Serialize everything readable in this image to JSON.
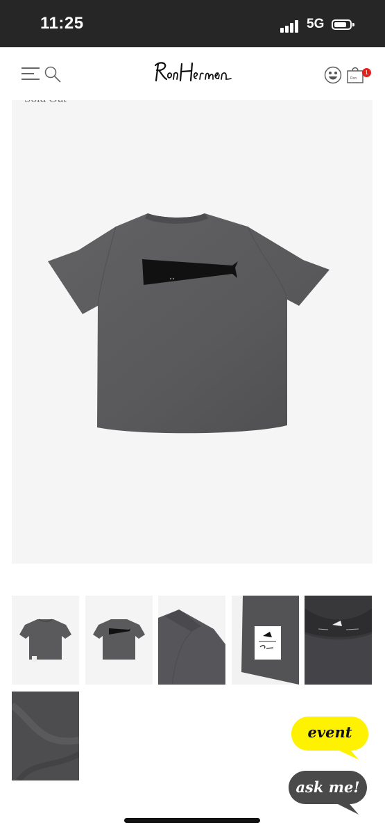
{
  "status_bar": {
    "time": "11:25",
    "network": "5G"
  },
  "header": {
    "logo_text": "Ron Herman",
    "cart_count": "1",
    "icons": [
      "menu-icon",
      "search-icon",
      "account-icon",
      "shopping-bag-icon"
    ]
  },
  "product": {
    "status": "Sold Out",
    "shirt_color": "#5a5a5c",
    "print_color": "#111111"
  },
  "thumbnails": [
    {
      "label": "front view"
    },
    {
      "label": "back view"
    },
    {
      "label": "side detail"
    },
    {
      "label": "tag detail"
    },
    {
      "label": "collar label detail"
    },
    {
      "label": "fabric detail"
    }
  ],
  "chat": {
    "event_label": "event",
    "ask_label": "ask me!",
    "event_color": "#fff200",
    "ask_color": "#4a4a4a"
  }
}
